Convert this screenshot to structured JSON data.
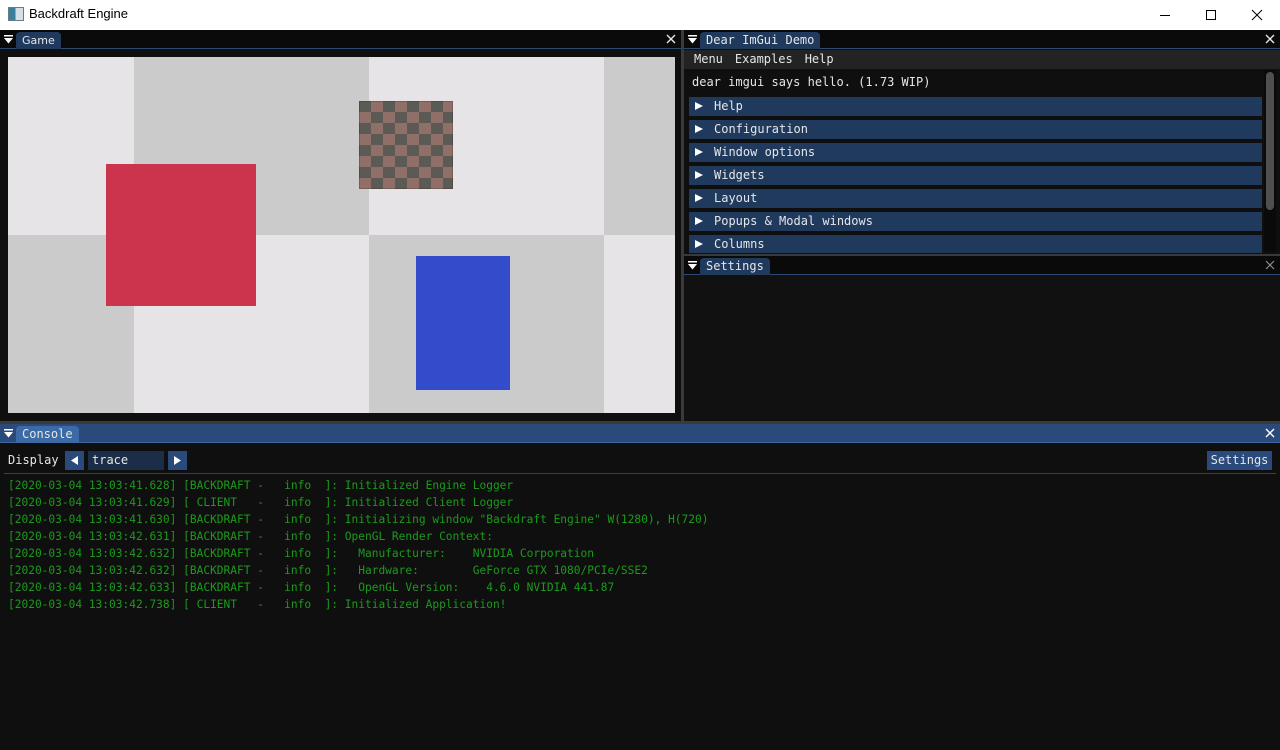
{
  "window": {
    "title": "Backdraft Engine",
    "controls": {
      "minimize": "minimize-icon",
      "maximize": "maximize-icon",
      "close": "close-icon"
    }
  },
  "game": {
    "tab_label": "Game",
    "scene": {
      "checker_colors": {
        "light": "#e6e4e6",
        "dark": "#cacbca"
      },
      "objects": [
        {
          "name": "red-quad",
          "color": "#cc334d"
        },
        {
          "name": "textured-quad",
          "texture": "checkerboard stone tiles"
        },
        {
          "name": "blue-quad",
          "color": "#334ccc"
        }
      ]
    }
  },
  "demo": {
    "tab_label": "Dear ImGui Demo",
    "menu": [
      "Menu",
      "Examples",
      "Help"
    ],
    "hello_text": "dear imgui says hello. (1.73 WIP)",
    "sections": [
      "Help",
      "Configuration",
      "Window options",
      "Widgets",
      "Layout",
      "Popups & Modal windows",
      "Columns"
    ]
  },
  "settings_panel": {
    "tab_label": "Settings"
  },
  "console": {
    "tab_label": "Console",
    "display_label": "Display",
    "level_value": "trace",
    "settings_button": "Settings",
    "text_color": "#1c9a1c",
    "lines": [
      "[2020-03-04 13:03:41.628] [BACKDRAFT -   info  ]: Initialized Engine Logger",
      "[2020-03-04 13:03:41.629] [ CLIENT   -   info  ]: Initialized Client Logger",
      "[2020-03-04 13:03:41.630] [BACKDRAFT -   info  ]: Initializing window \"Backdraft Engine\" W(1280), H(720)",
      "[2020-03-04 13:03:42.631] [BACKDRAFT -   info  ]: OpenGL Render Context:",
      "[2020-03-04 13:03:42.632] [BACKDRAFT -   info  ]:   Manufacturer:    NVIDIA Corporation",
      "[2020-03-04 13:03:42.632] [BACKDRAFT -   info  ]:   Hardware:        GeForce GTX 1080/PCIe/SSE2",
      "[2020-03-04 13:03:42.633] [BACKDRAFT -   info  ]:   OpenGL Version:    4.6.0 NVIDIA 441.87",
      "[2020-03-04 13:03:42.738] [ CLIENT   -   info  ]: Initialized Application!"
    ]
  }
}
